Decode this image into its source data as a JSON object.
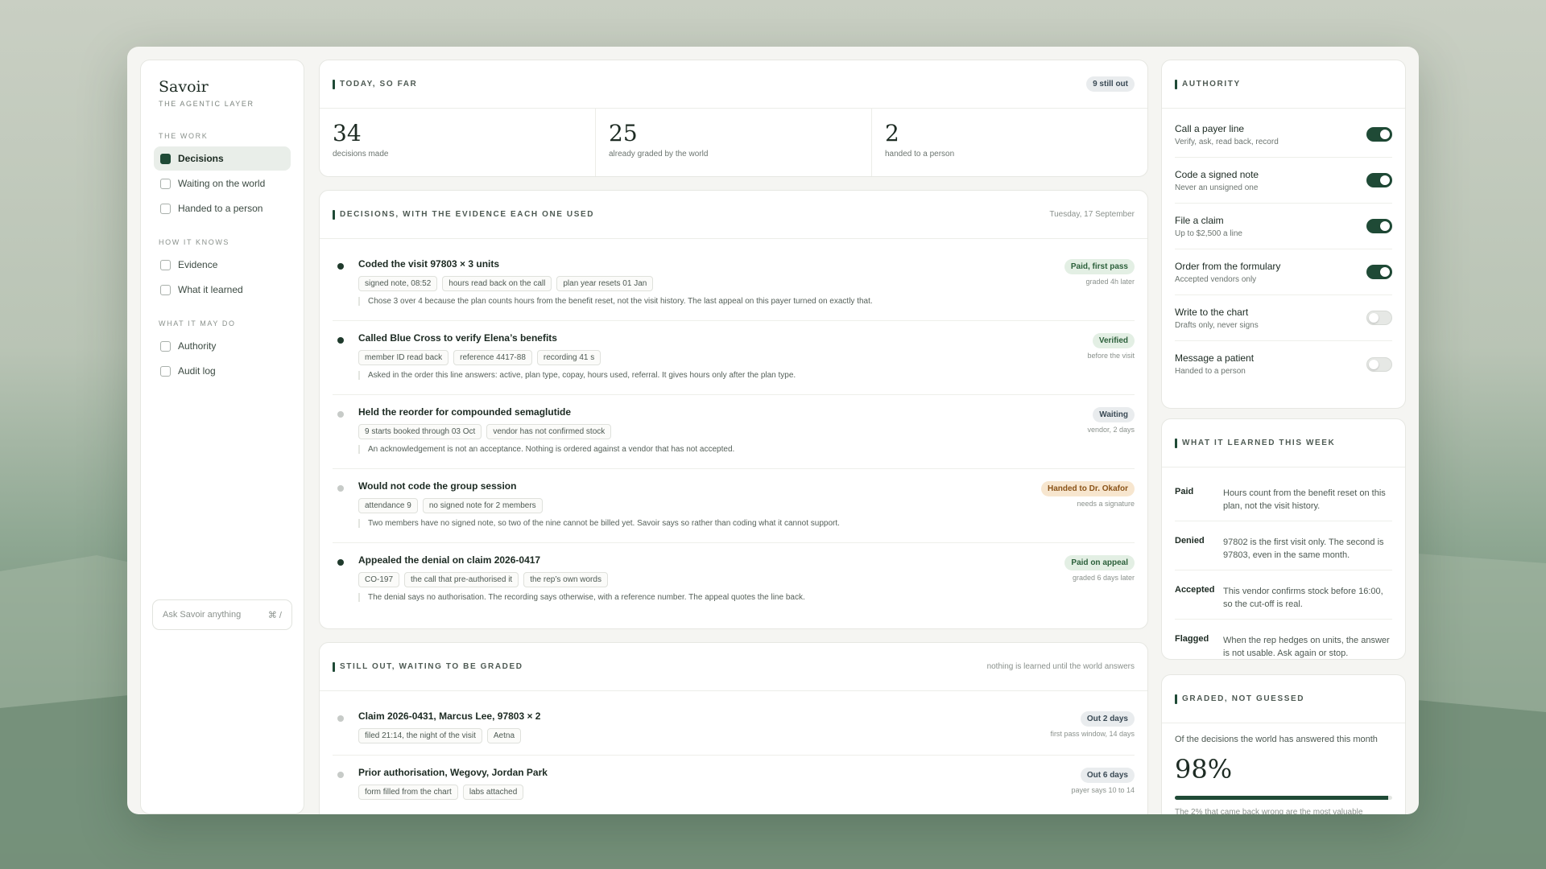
{
  "brand": {
    "name": "Savoir",
    "tagline": "THE AGENTIC LAYER"
  },
  "sidebar": {
    "sections": [
      {
        "title": "THE WORK",
        "items": [
          {
            "label": "Decisions",
            "active": true
          },
          {
            "label": "Waiting on the world",
            "active": false
          },
          {
            "label": "Handed to a person",
            "active": false
          }
        ]
      },
      {
        "title": "HOW IT KNOWS",
        "items": [
          {
            "label": "Evidence",
            "active": false
          },
          {
            "label": "What it learned",
            "active": false
          }
        ]
      },
      {
        "title": "WHAT IT MAY DO",
        "items": [
          {
            "label": "Authority",
            "active": false
          },
          {
            "label": "Audit log",
            "active": false
          }
        ]
      }
    ],
    "ask": {
      "placeholder": "Ask Savoir anything",
      "shortcut": "⌘ /"
    }
  },
  "today": {
    "title": "TODAY, SO FAR",
    "badge": "9 still out",
    "stats": [
      {
        "value": "34",
        "label": "decisions made"
      },
      {
        "value": "25",
        "label": "already graded by the world"
      },
      {
        "value": "2",
        "label": "handed to a person"
      }
    ]
  },
  "decisions": {
    "title": "DECISIONS, WITH THE EVIDENCE EACH ONE USED",
    "date": "Tuesday, 17 September",
    "rows": [
      {
        "title": "Coded the visit 97803 × 3 units",
        "dot": "dark",
        "tags": [
          "signed note, 08:52",
          "hours read back on the call",
          "plan year resets 01 Jan"
        ],
        "note": "Chose 3 over 4 because the plan counts hours from the benefit reset, not the visit history. The last appeal on this payer turned on exactly that.",
        "status": "Paid, first pass",
        "status_tone": "green",
        "sub": "graded 4h later"
      },
      {
        "title": "Called Blue Cross to verify Elena’s benefits",
        "dot": "dark",
        "tags": [
          "member ID read back",
          "reference 4417-88",
          "recording 41 s"
        ],
        "note": "Asked in the order this line answers: active, plan type, copay, hours used, referral. It gives hours only after the plan type.",
        "status": "Verified",
        "status_tone": "green",
        "sub": "before the visit"
      },
      {
        "title": "Held the reorder for compounded semaglutide",
        "dot": "light",
        "tags": [
          "9 starts booked through 03 Oct",
          "vendor has not confirmed stock"
        ],
        "note": "An acknowledgement is not an acceptance. Nothing is ordered against a vendor that has not accepted.",
        "status": "Waiting",
        "status_tone": "grey",
        "sub": "vendor, 2 days"
      },
      {
        "title": "Would not code the group session",
        "dot": "light",
        "tags": [
          "attendance 9",
          "no signed note for 2 members"
        ],
        "note": "Two members have no signed note, so two of the nine cannot be billed yet. Savoir says so rather than coding what it cannot support.",
        "status": "Handed to Dr. Okafor",
        "status_tone": "orange",
        "sub": "needs a signature"
      },
      {
        "title": "Appealed the denial on claim 2026-0417",
        "dot": "dark",
        "tags": [
          "CO-197",
          "the call that pre-authorised it",
          "the rep’s own words"
        ],
        "note": "The denial says no authorisation. The recording says otherwise, with a reference number. The appeal quotes the line back.",
        "status": "Paid on appeal",
        "status_tone": "green",
        "sub": "graded 6 days later"
      }
    ]
  },
  "waiting": {
    "title": "STILL OUT, WAITING TO BE GRADED",
    "note": "nothing is learned until the world answers",
    "rows": [
      {
        "title": "Claim 2026-0431, Marcus Lee, 97803 × 2",
        "tags": [
          "filed 21:14, the night of the visit",
          "Aetna"
        ],
        "status": "Out 2 days",
        "sub": "first pass window, 14 days"
      },
      {
        "title": "Prior authorisation, Wegovy, Jordan Park",
        "tags": [
          "form filled from the chart",
          "labs attached"
        ],
        "status": "Out 6 days",
        "sub": "payer says 10 to 14"
      }
    ]
  },
  "authority": {
    "title": "AUTHORITY",
    "items": [
      {
        "name": "Call a payer line",
        "sub": "Verify, ask, read back, record",
        "on": true
      },
      {
        "name": "Code a signed note",
        "sub": "Never an unsigned one",
        "on": true
      },
      {
        "name": "File a claim",
        "sub": "Up to $2,500 a line",
        "on": true
      },
      {
        "name": "Order from the formulary",
        "sub": "Accepted vendors only",
        "on": true
      },
      {
        "name": "Write to the chart",
        "sub": "Drafts only, never signs",
        "on": false
      },
      {
        "name": "Message a patient",
        "sub": "Handed to a person",
        "on": false
      }
    ]
  },
  "learned": {
    "title": "WHAT IT LEARNED THIS WEEK",
    "items": [
      {
        "key": "Paid",
        "value": "Hours count from the benefit reset on this plan, not the visit history."
      },
      {
        "key": "Denied",
        "value": "97802 is the first visit only. The second is 97803, even in the same month."
      },
      {
        "key": "Accepted",
        "value": "This vendor confirms stock before 16:00, so the cut-off is real."
      },
      {
        "key": "Flagged",
        "value": "When the rep hedges on units, the answer is not usable. Ask again or stop."
      }
    ]
  },
  "graded": {
    "title": "GRADED, NOT GUESSED",
    "text": "Of the decisions the world has answered this month",
    "value": "98%",
    "progress": 0.98,
    "foot": "The 2% that came back wrong are the most valuable"
  },
  "colors": {
    "accent": "#1f4a36",
    "status_green": "#2b5f3a",
    "status_orange": "#8a5318"
  }
}
